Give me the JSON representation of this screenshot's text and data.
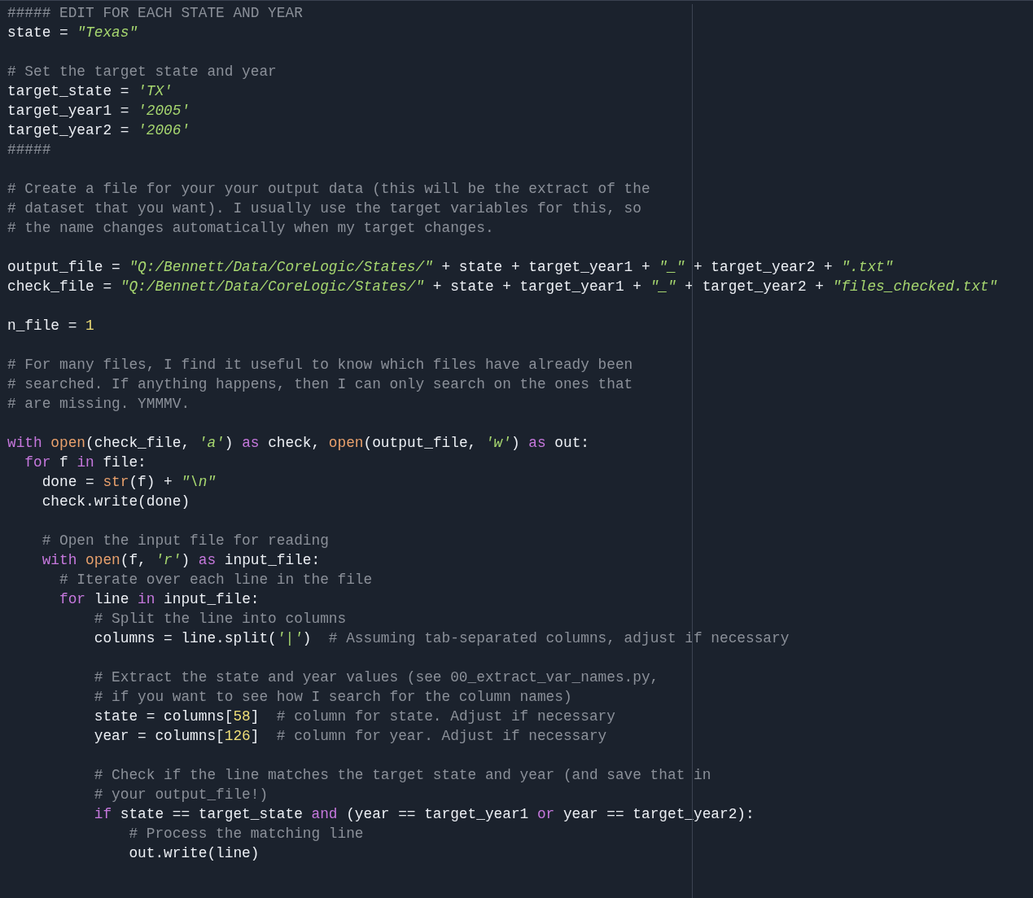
{
  "editor": {
    "lines": [
      {
        "kind": "code",
        "tokens": [
          {
            "kind": "comment",
            "text": "##### EDIT FOR EACH STATE AND YEAR"
          }
        ]
      },
      {
        "kind": "code",
        "tokens": [
          {
            "kind": "plain",
            "text": "state = "
          },
          {
            "kind": "string",
            "text": "\"Texas\""
          }
        ]
      },
      {
        "kind": "blank"
      },
      {
        "kind": "code",
        "tokens": [
          {
            "kind": "comment",
            "text": "# Set the target state and year"
          }
        ]
      },
      {
        "kind": "code",
        "tokens": [
          {
            "kind": "plain",
            "text": "target_state = "
          },
          {
            "kind": "string",
            "text": "'TX'"
          }
        ]
      },
      {
        "kind": "code",
        "tokens": [
          {
            "kind": "plain",
            "text": "target_year1 = "
          },
          {
            "kind": "string",
            "text": "'2005'"
          }
        ]
      },
      {
        "kind": "code",
        "tokens": [
          {
            "kind": "plain",
            "text": "target_year2 = "
          },
          {
            "kind": "string",
            "text": "'2006'"
          }
        ]
      },
      {
        "kind": "code",
        "tokens": [
          {
            "kind": "comment",
            "text": "#####"
          }
        ]
      },
      {
        "kind": "blank"
      },
      {
        "kind": "code",
        "tokens": [
          {
            "kind": "comment",
            "text": "# Create a file for your your output data (this will be the extract of the"
          }
        ]
      },
      {
        "kind": "code",
        "tokens": [
          {
            "kind": "comment",
            "text": "# dataset that you want). I usually use the target variables for this, so"
          }
        ]
      },
      {
        "kind": "code",
        "tokens": [
          {
            "kind": "comment",
            "text": "# the name changes automatically when my target changes."
          }
        ]
      },
      {
        "kind": "blank"
      },
      {
        "kind": "code",
        "tokens": [
          {
            "kind": "plain",
            "text": "output_file = "
          },
          {
            "kind": "string",
            "text": "\"Q:/Bennett/Data/CoreLogic/States/\""
          },
          {
            "kind": "plain",
            "text": " + state + target_year1 + "
          },
          {
            "kind": "string",
            "text": "\"_\""
          },
          {
            "kind": "plain",
            "text": " + target_year2 + "
          },
          {
            "kind": "string",
            "text": "\".txt\""
          }
        ]
      },
      {
        "kind": "code",
        "tokens": [
          {
            "kind": "plain",
            "text": "check_file = "
          },
          {
            "kind": "string",
            "text": "\"Q:/Bennett/Data/CoreLogic/States/\""
          },
          {
            "kind": "plain",
            "text": " + state + target_year1 + "
          },
          {
            "kind": "string",
            "text": "\"_\""
          },
          {
            "kind": "plain",
            "text": " + target_year2 + "
          },
          {
            "kind": "string",
            "text": "\"files_checked.txt\""
          }
        ]
      },
      {
        "kind": "blank"
      },
      {
        "kind": "code",
        "tokens": [
          {
            "kind": "plain",
            "text": "n_file = "
          },
          {
            "kind": "number",
            "text": "1"
          }
        ]
      },
      {
        "kind": "blank"
      },
      {
        "kind": "code",
        "tokens": [
          {
            "kind": "comment",
            "text": "# For many files, I find it useful to know which files have already been"
          }
        ]
      },
      {
        "kind": "code",
        "tokens": [
          {
            "kind": "comment",
            "text": "# searched. If anything happens, then I can only search on the ones that"
          }
        ]
      },
      {
        "kind": "code",
        "tokens": [
          {
            "kind": "comment",
            "text": "# are missing. YMMMV."
          }
        ]
      },
      {
        "kind": "blank"
      },
      {
        "kind": "code",
        "tokens": [
          {
            "kind": "keyword",
            "text": "with "
          },
          {
            "kind": "builtin",
            "text": "open"
          },
          {
            "kind": "plain",
            "text": "(check_file, "
          },
          {
            "kind": "string",
            "text": "'a'"
          },
          {
            "kind": "plain",
            "text": ") "
          },
          {
            "kind": "keyword",
            "text": "as"
          },
          {
            "kind": "plain",
            "text": " check, "
          },
          {
            "kind": "builtin",
            "text": "open"
          },
          {
            "kind": "plain",
            "text": "(output_file, "
          },
          {
            "kind": "string",
            "text": "'w'"
          },
          {
            "kind": "plain",
            "text": ") "
          },
          {
            "kind": "keyword",
            "text": "as"
          },
          {
            "kind": "plain",
            "text": " out:"
          }
        ]
      },
      {
        "kind": "code",
        "tokens": [
          {
            "kind": "keyword",
            "text": "  for"
          },
          {
            "kind": "plain",
            "text": " f "
          },
          {
            "kind": "keyword",
            "text": "in"
          },
          {
            "kind": "plain",
            "text": " file:"
          }
        ]
      },
      {
        "kind": "code",
        "tokens": [
          {
            "kind": "plain",
            "text": "    done = "
          },
          {
            "kind": "builtin",
            "text": "str"
          },
          {
            "kind": "plain",
            "text": "(f) + "
          },
          {
            "kind": "string",
            "text": "\"\\n\""
          }
        ]
      },
      {
        "kind": "code",
        "tokens": [
          {
            "kind": "plain",
            "text": "    check.write(done)"
          }
        ]
      },
      {
        "kind": "blank"
      },
      {
        "kind": "code",
        "tokens": [
          {
            "kind": "comment",
            "text": "    # Open the input file for reading"
          }
        ]
      },
      {
        "kind": "code",
        "tokens": [
          {
            "kind": "keyword",
            "text": "    with "
          },
          {
            "kind": "builtin",
            "text": "open"
          },
          {
            "kind": "plain",
            "text": "(f, "
          },
          {
            "kind": "string",
            "text": "'r'"
          },
          {
            "kind": "plain",
            "text": ") "
          },
          {
            "kind": "keyword",
            "text": "as"
          },
          {
            "kind": "plain",
            "text": " input_file:"
          }
        ]
      },
      {
        "kind": "code",
        "tokens": [
          {
            "kind": "comment",
            "text": "      # Iterate over each line in the file"
          }
        ]
      },
      {
        "kind": "code",
        "tokens": [
          {
            "kind": "keyword",
            "text": "      for"
          },
          {
            "kind": "plain",
            "text": " line "
          },
          {
            "kind": "keyword",
            "text": "in"
          },
          {
            "kind": "plain",
            "text": " input_file:"
          }
        ]
      },
      {
        "kind": "code",
        "tokens": [
          {
            "kind": "comment",
            "text": "          # Split the line into columns"
          }
        ]
      },
      {
        "kind": "code",
        "tokens": [
          {
            "kind": "plain",
            "text": "          columns = line.split("
          },
          {
            "kind": "string",
            "text": "'|'"
          },
          {
            "kind": "plain",
            "text": ")  "
          },
          {
            "kind": "comment",
            "text": "# Assuming tab-separated columns, adjust if necessary"
          }
        ]
      },
      {
        "kind": "blank"
      },
      {
        "kind": "code",
        "tokens": [
          {
            "kind": "comment",
            "text": "          # Extract the state and year values (see 00_extract_var_names.py,"
          }
        ]
      },
      {
        "kind": "code",
        "tokens": [
          {
            "kind": "comment",
            "text": "          # if you want to see how I search for the column names)"
          }
        ]
      },
      {
        "kind": "code",
        "tokens": [
          {
            "kind": "plain",
            "text": "          state = columns["
          },
          {
            "kind": "number",
            "text": "58"
          },
          {
            "kind": "plain",
            "text": "]  "
          },
          {
            "kind": "comment",
            "text": "# column for state. Adjust if necessary"
          }
        ]
      },
      {
        "kind": "code",
        "tokens": [
          {
            "kind": "plain",
            "text": "          year = columns["
          },
          {
            "kind": "number",
            "text": "126"
          },
          {
            "kind": "plain",
            "text": "]  "
          },
          {
            "kind": "comment",
            "text": "# column for year. Adjust if necessary"
          }
        ]
      },
      {
        "kind": "blank"
      },
      {
        "kind": "code",
        "tokens": [
          {
            "kind": "comment",
            "text": "          # Check if the line matches the target state and year (and save that in"
          }
        ]
      },
      {
        "kind": "code",
        "tokens": [
          {
            "kind": "comment",
            "text": "          # your output_file!)"
          }
        ]
      },
      {
        "kind": "code",
        "tokens": [
          {
            "kind": "keyword",
            "text": "          if"
          },
          {
            "kind": "plain",
            "text": " state == target_state "
          },
          {
            "kind": "keyword",
            "text": "and"
          },
          {
            "kind": "plain",
            "text": " (year == target_year1 "
          },
          {
            "kind": "keyword",
            "text": "or"
          },
          {
            "kind": "plain",
            "text": " year == target_year2):"
          }
        ]
      },
      {
        "kind": "code",
        "tokens": [
          {
            "kind": "comment",
            "text": "              # Process the matching line"
          }
        ]
      },
      {
        "kind": "code",
        "tokens": [
          {
            "kind": "plain",
            "text": "              out.write(line)"
          }
        ]
      }
    ]
  }
}
